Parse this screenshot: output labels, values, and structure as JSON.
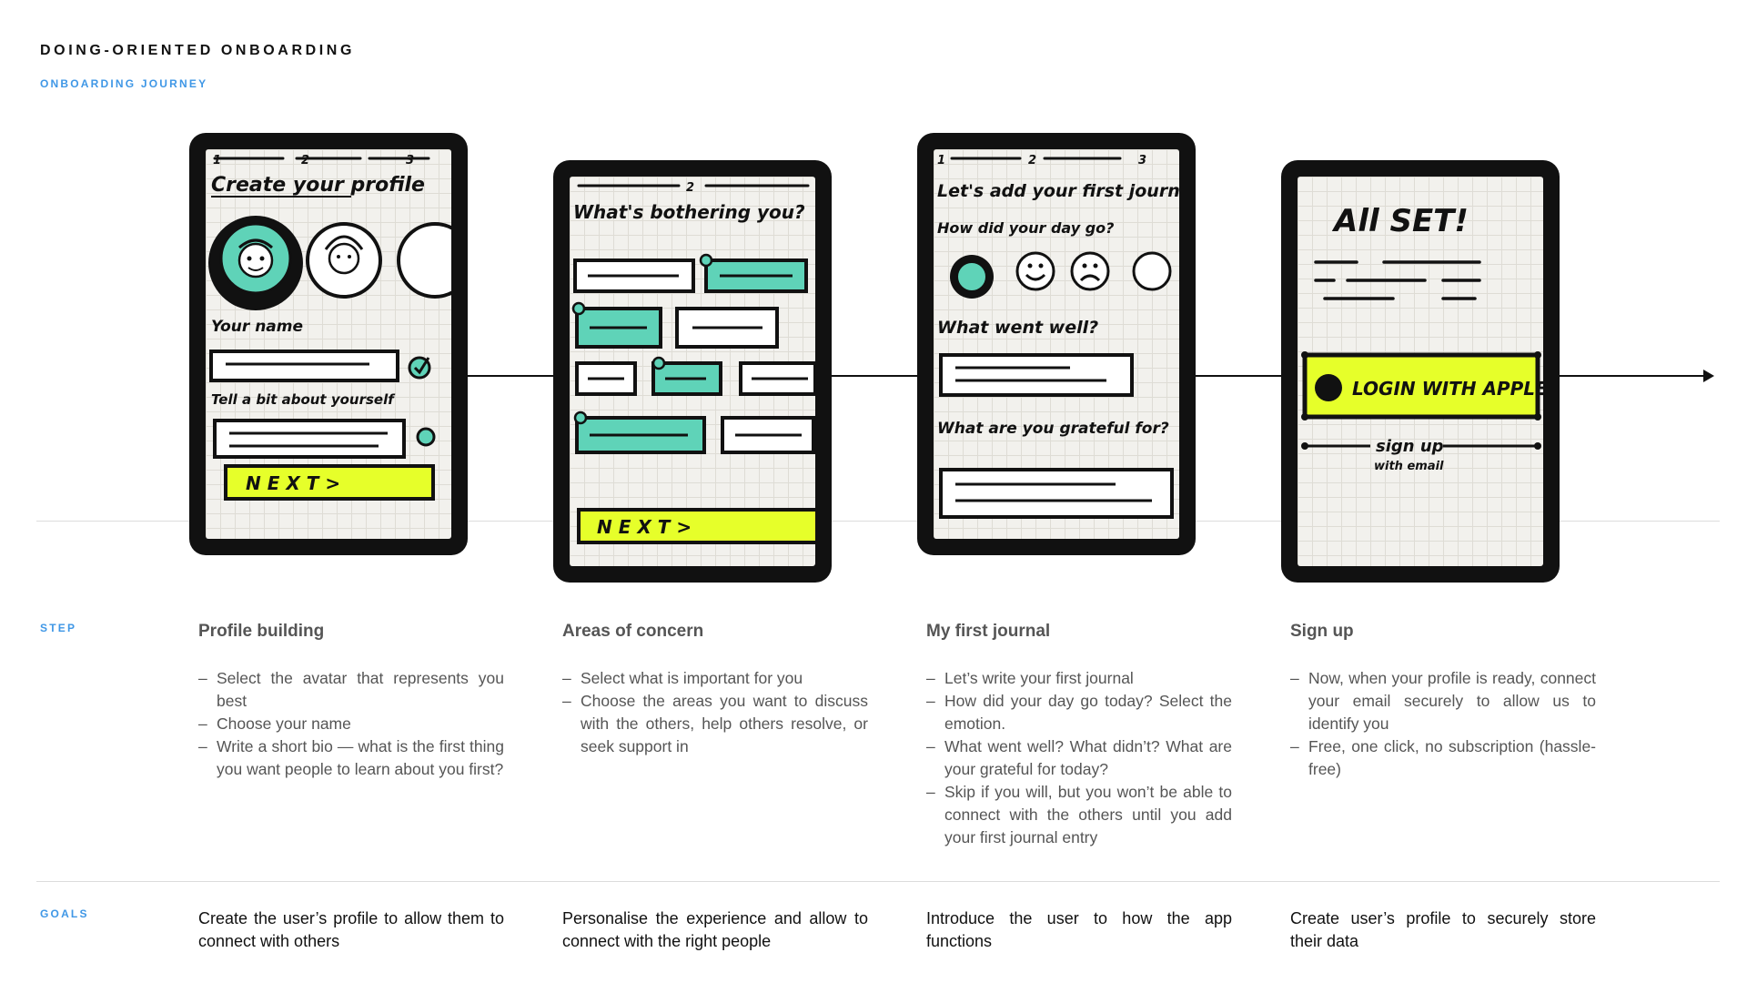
{
  "header": {
    "title": "DOING-ORIENTED ONBOARDING",
    "subtitle": "ONBOARDING JOURNEY"
  },
  "labels": {
    "step": "STEP",
    "goals": "GOALS"
  },
  "colors": {
    "accent_blue": "#3f97e6",
    "mint": "#5fd3b8",
    "highlighter_yellow": "#e6ff2a",
    "ink": "#111111"
  },
  "screens": [
    {
      "progress": [
        "1",
        "2",
        "3"
      ],
      "heading": "Create your profile",
      "name_label": "Your name",
      "bio_label": "Tell a bit about yourself",
      "button": "N E X T >"
    },
    {
      "progress": [
        "2"
      ],
      "heading": "What's bothering you?",
      "button": "N E X T >"
    },
    {
      "progress": [
        "1",
        "2",
        "3"
      ],
      "heading": "Let's add your first journal",
      "question": "How did your day go?",
      "went_well": "What went well?",
      "grateful": "What are you grateful for?"
    },
    {
      "heading": "All SET!",
      "login_button": "LOGIN WITH APPLE",
      "signup_link": "sign up",
      "signup_sub": "with email"
    }
  ],
  "steps": [
    {
      "title": "Profile building",
      "bullets": [
        "Select the avatar that represents you best",
        "Choose your name",
        "Write a short bio — what is the first thing you want people to learn about you first?"
      ],
      "goal": "Create the user’s profile to allow them to connect with others"
    },
    {
      "title": "Areas of concern",
      "bullets": [
        "Select what is important for you",
        "Choose the areas you want to discuss with the others, help others resolve, or seek support in"
      ],
      "goal": "Personalise the experience and allow to connect with the right people"
    },
    {
      "title": "My first journal",
      "bullets": [
        "Let’s write your first journal",
        "How did your day go today? Select the emotion.",
        "What went well? What didn’t? What are your grateful for today?",
        "Skip if you will, but you won’t be able to connect with the others until you add your first journal entry"
      ],
      "goal": "Introduce the user to how the app functions"
    },
    {
      "title": "Sign up",
      "bullets": [
        "Now, when your profile is ready, connect your email securely to allow us to identify you",
        "Free, one click, no subscription (hassle-free)"
      ],
      "goal": "Create user’s profile to securely store their data"
    }
  ]
}
